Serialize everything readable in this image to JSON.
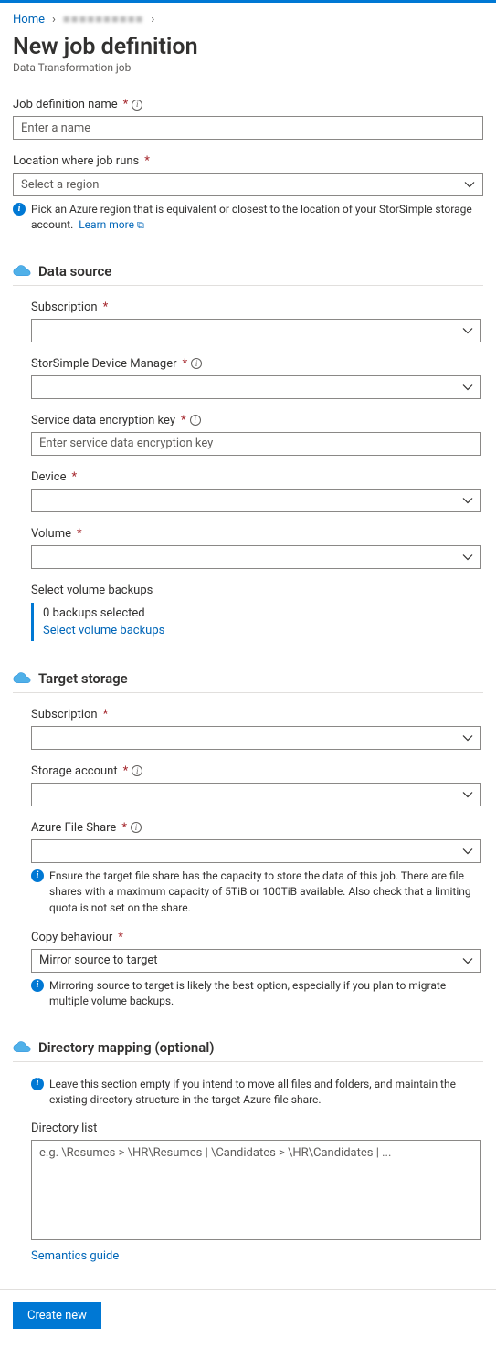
{
  "breadcrumb": {
    "home": "Home",
    "mid": "■■■■■■■■■■"
  },
  "page": {
    "title": "New job definition",
    "subtitle": "Data Transformation job"
  },
  "fields": {
    "jobName": {
      "label": "Job definition name",
      "placeholder": "Enter a name"
    },
    "location": {
      "label": "Location where job runs",
      "placeholder": "Select a region",
      "help": "Pick an Azure region that is equivalent or closest to the location of your StorSimple storage account.",
      "learnMore": "Learn more"
    }
  },
  "dataSource": {
    "title": "Data source",
    "subscription": {
      "label": "Subscription"
    },
    "deviceManager": {
      "label": "StorSimple Device Manager"
    },
    "encryptionKey": {
      "label": "Service data encryption key",
      "placeholder": "Enter service data encryption key"
    },
    "device": {
      "label": "Device"
    },
    "volume": {
      "label": "Volume"
    },
    "backups": {
      "label": "Select volume backups",
      "status": "0 backups selected",
      "link": "Select volume backups"
    }
  },
  "targetStorage": {
    "title": "Target storage",
    "subscription": {
      "label": "Subscription"
    },
    "storageAccount": {
      "label": "Storage account"
    },
    "fileShare": {
      "label": "Azure File Share",
      "help": "Ensure the target file share has the capacity to store the data of this job. There are file shares with a maximum capacity of 5TiB or 100TiB available. Also check that a limiting quota is not set on the share."
    },
    "copyBehaviour": {
      "label": "Copy behaviour",
      "value": "Mirror source to target",
      "help": "Mirroring source to target is likely the best option, especially if you plan to migrate multiple volume backups."
    }
  },
  "directoryMapping": {
    "title": "Directory mapping (optional)",
    "help": "Leave this section empty if you intend to move all files and folders, and maintain the existing directory structure in the target Azure file share.",
    "listLabel": "Directory list",
    "placeholder": "e.g. \\Resumes > \\HR\\Resumes | \\Candidates > \\HR\\Candidates | ...",
    "semanticsLink": "Semantics guide"
  },
  "footer": {
    "create": "Create new"
  }
}
